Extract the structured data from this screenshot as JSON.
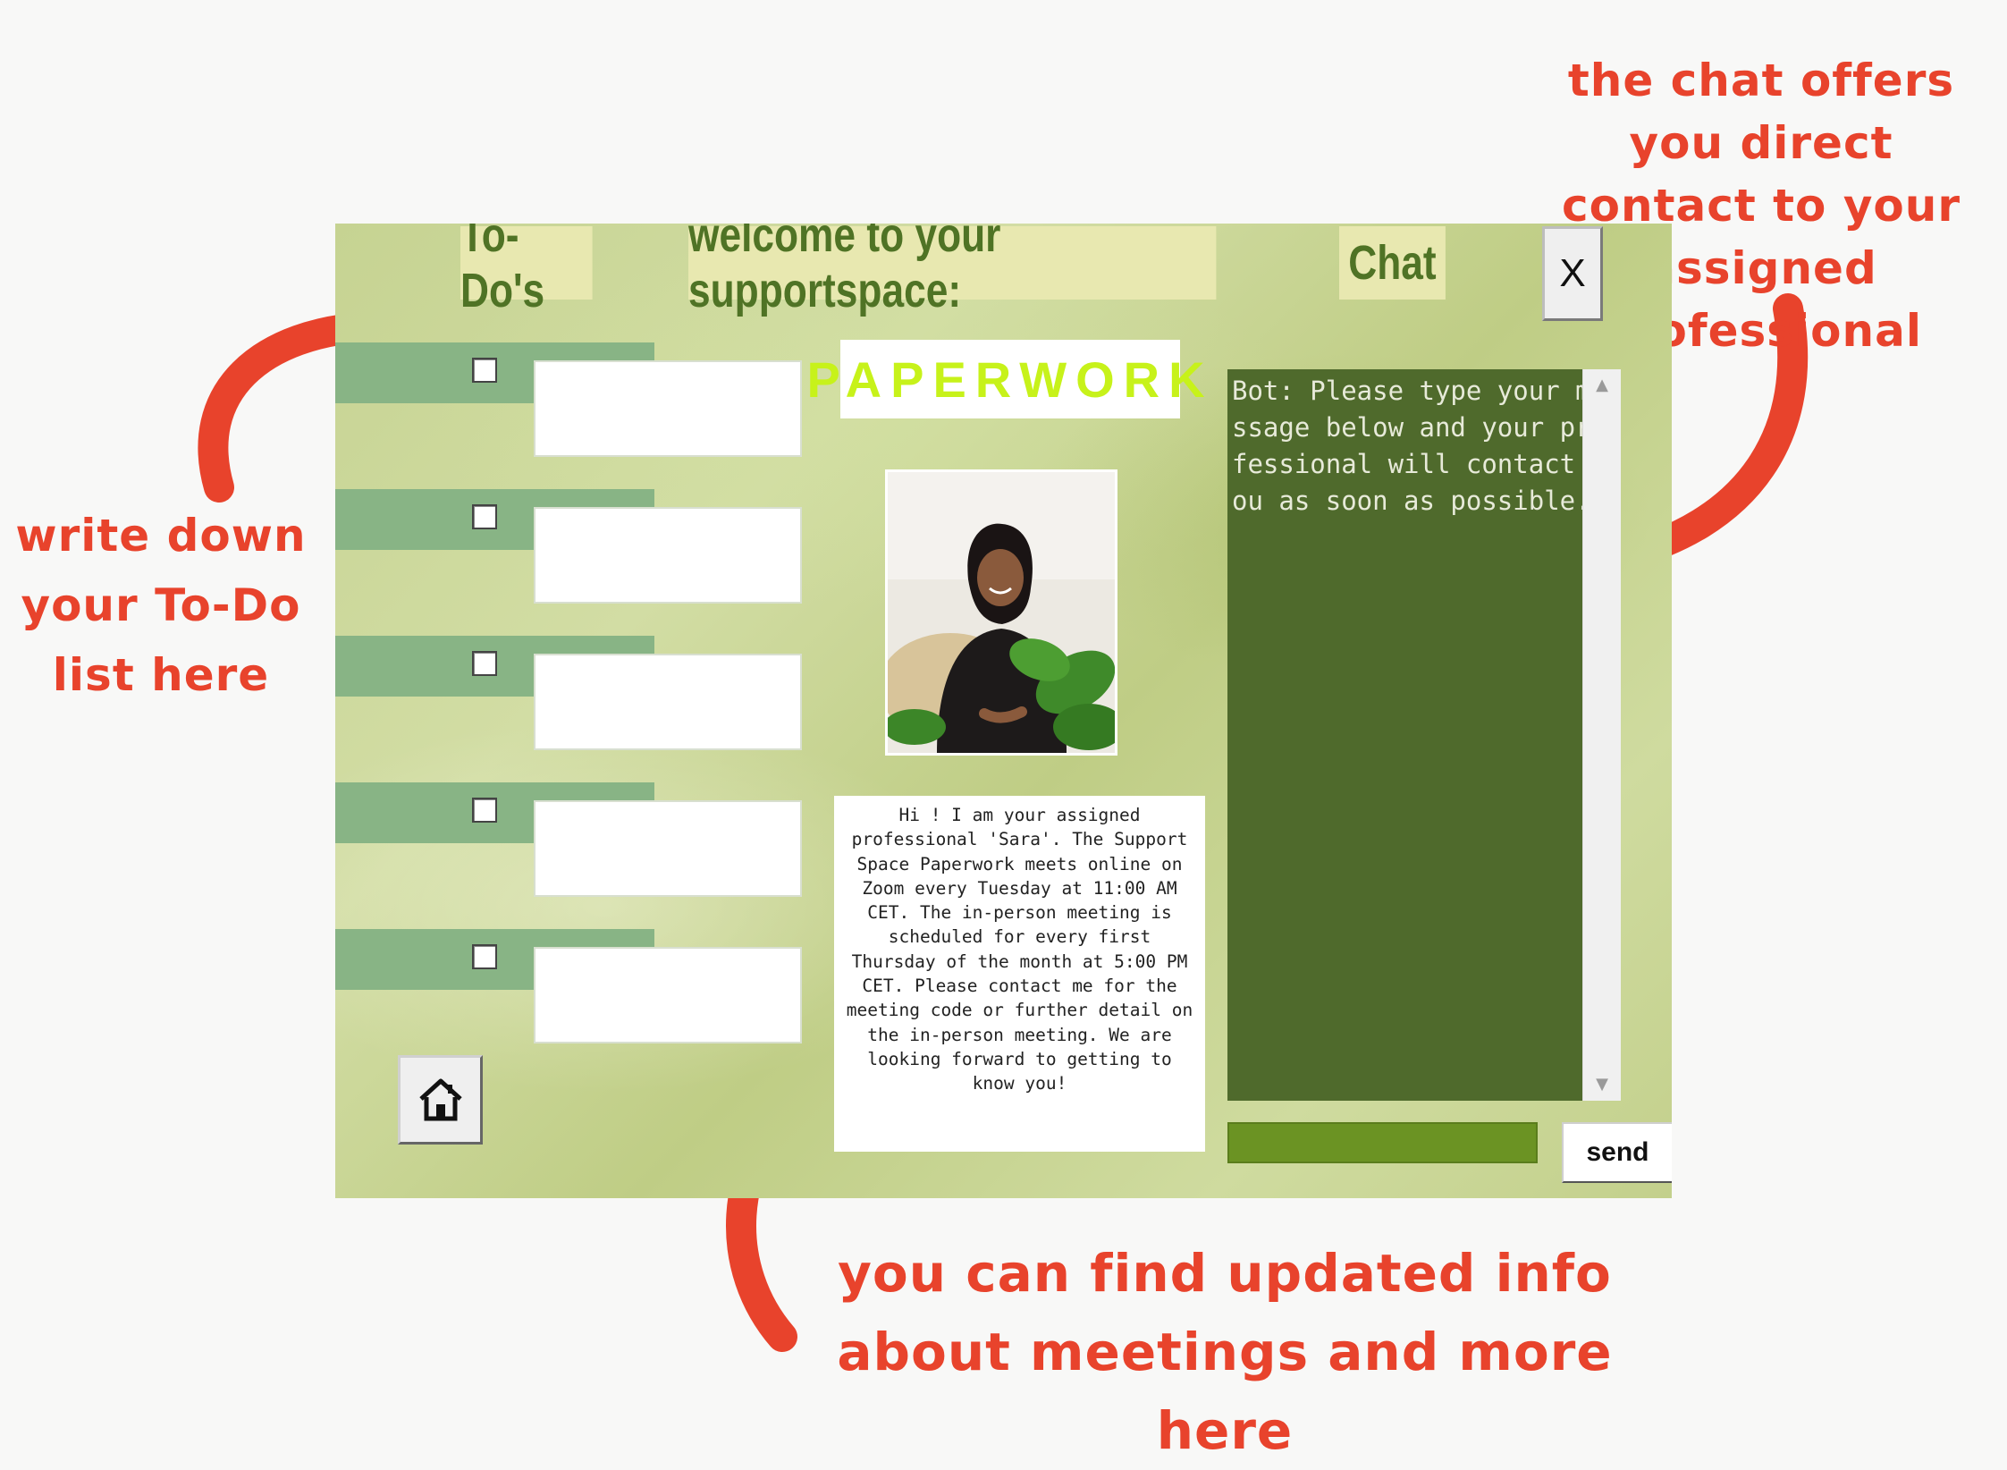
{
  "annotations": {
    "todo": "write down your To-Do list here",
    "chat": "the chat offers you direct contact to your assigned professional",
    "info": "you can find updated info about meetings and more here"
  },
  "header": {
    "todos_tab": "To-Do's",
    "welcome": "welcome to your supportspace:",
    "chat_tab": "Chat",
    "close_label": "X"
  },
  "todo_items": [
    {
      "checked": false,
      "value": ""
    },
    {
      "checked": false,
      "value": ""
    },
    {
      "checked": false,
      "value": ""
    },
    {
      "checked": false,
      "value": ""
    },
    {
      "checked": false,
      "value": ""
    }
  ],
  "space_label": "PAPERWORK",
  "info_text": "Hi ! I am your assigned professional 'Sara'. The Support Space Paperwork meets online on Zoom every Tuesday at 11:00 AM CET. The in-person meeting is scheduled for every first Thursday of the month at 5:00 PM CET. Please contact me for the meeting code or further detail on the in-person meeting. We are looking forward to getting to know you!",
  "chat": {
    "message": "Bot: Please type your message below and your professional will contact you as soon as possible.",
    "input_value": "",
    "send_label": "send"
  },
  "icons": {
    "home": "home-icon",
    "scroll_up": "scroll-up-icon",
    "scroll_down": "scroll-down-icon"
  },
  "colors": {
    "annotation": "#e8432c",
    "header_text": "#4f7325",
    "chat_panel": "#4f6a2c",
    "paperwork_text": "#c7f21a",
    "todo_strip": "#88b485"
  }
}
